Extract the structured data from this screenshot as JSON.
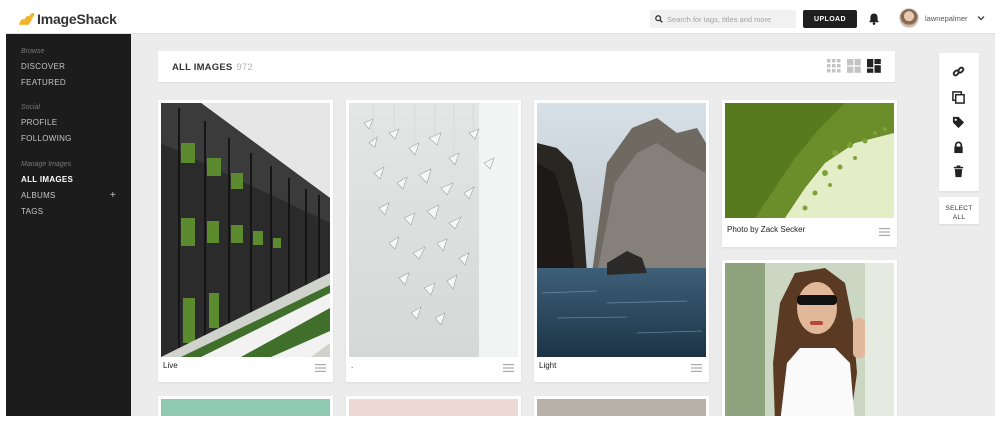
{
  "header": {
    "logo_text": "ImageShack",
    "search_placeholder": "Search for tags, titles and more",
    "upload_label": "UPLOAD",
    "username": "lawnepalmer"
  },
  "sidebar": {
    "groups": [
      {
        "heading": "Browse",
        "items": [
          "DISCOVER",
          "FEATURED"
        ]
      },
      {
        "heading": "Social",
        "items": [
          "PROFILE",
          "FOLLOWING"
        ]
      },
      {
        "heading": "Manage Images",
        "items": [
          "ALL IMAGES",
          "ALBUMS",
          "TAGS"
        ]
      }
    ],
    "active_item": "ALL IMAGES",
    "albums_add": "+"
  },
  "main": {
    "title": "ALL IMAGES",
    "count": "972",
    "view_icons": [
      "small-grid-icon",
      "medium-grid-icon",
      "mosaic-grid-icon"
    ],
    "cards": [
      {
        "caption": "Live",
        "subject": "modern-building-with-plants"
      },
      {
        "caption": ".",
        "subject": "paper-cranes"
      },
      {
        "caption": "Light",
        "subject": "sea-cliff"
      },
      {
        "caption": "Photo by Zack Secker",
        "subject": "green-lily-pads"
      },
      {
        "caption": "",
        "subject": "woman-with-sunglasses"
      },
      {
        "caption": "",
        "subject": "mint-image"
      },
      {
        "caption": "",
        "subject": "pink-image"
      },
      {
        "caption": "",
        "subject": "grey-image"
      }
    ]
  },
  "tools": {
    "icons": [
      "link-icon",
      "copy-icon",
      "tag-icon",
      "lock-icon",
      "trash-icon"
    ],
    "select_all_line1": "SELECT",
    "select_all_line2": "ALL"
  },
  "colors": {
    "sidebar_bg": "#1c1c1c",
    "page_bg": "#ececec",
    "upload_bg": "#1f1f1f",
    "logo_accent": "#f2b324"
  }
}
